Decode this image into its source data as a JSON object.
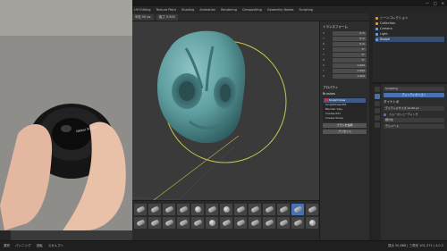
{
  "window": {
    "title": "(未保存) - Blender 4.0",
    "controls": [
      "—",
      "□",
      "✕"
    ]
  },
  "menubar": {
    "menus": [
      "ファイル",
      "編集",
      "レンダー",
      "ウィンドウ",
      "ヘルプ"
    ],
    "workspaces": [
      "Layout",
      "Modeling",
      "Sculpting",
      "UV Editing",
      "Texture Paint",
      "Shading",
      "Animation",
      "Rendering",
      "Compositing",
      "Geometry Nodes",
      "Scripting"
    ],
    "active_workspace": "Sculpting"
  },
  "header": {
    "items": [
      "スカルプトモード",
      "ビュー",
      "スカルプト",
      "マスク",
      "面セット",
      "Draw",
      "半径 50 px",
      "強さ 0.500"
    ]
  },
  "toolbar": {
    "tools": [
      "draw",
      "draw-sharp",
      "clay",
      "clay-strips",
      "layer",
      "inflate",
      "blob",
      "crease",
      "smooth",
      "flatten",
      "fill",
      "scrape",
      "pinch",
      "grab",
      "snake-hook",
      "thumb",
      "pose",
      "nudge",
      "rotate",
      "mask"
    ],
    "active_index": 0
  },
  "camera_overlay": {
    "lens_label": "Nikkor 50mm"
  },
  "n_panel": {
    "transform_title": "トランスフォーム",
    "transform_rows": [
      {
        "label": "X",
        "value": "0 m"
      },
      {
        "label": "Y",
        "value": "0 m"
      },
      {
        "label": "Z",
        "value": "0 m"
      },
      {
        "label": "X",
        "value": "0°"
      },
      {
        "label": "Y",
        "value": "0°"
      },
      {
        "label": "Z",
        "value": "0°"
      },
      {
        "label": "X",
        "value": "1.000"
      },
      {
        "label": "Y",
        "value": "1.000"
      },
      {
        "label": "Z",
        "value": "1.000"
      }
    ],
    "properties_title": "プロパティ",
    "brush_title": "Brushes",
    "brush_list": [
      "Sculpt Draw",
      "SculptDraw.001",
      "Blender Clay",
      "Crease.001",
      "Crease Sharp"
    ],
    "brush_selected_index": 0,
    "apply_button": "ブラシを適用",
    "extra_label": "プリセット"
  },
  "outliner": {
    "items": [
      {
        "label": "シーンコレクション",
        "type": "collection"
      },
      {
        "label": "Collection",
        "type": "collection"
      },
      {
        "label": "Camera",
        "type": "object"
      },
      {
        "label": "Light",
        "type": "object"
      },
      {
        "label": "Sculpt",
        "type": "mesh"
      }
    ],
    "selected_index": 4
  },
  "properties": {
    "search_field": "Sculpting",
    "mode_button": "ディンティポリゴン",
    "section_title": "ダイナトポ",
    "detail_field": "ディティルサイズ 12.00 px",
    "option_label": "スムーズシェーディング",
    "refine_label": "細分化",
    "decimate_label": "デシメート"
  },
  "shelf": {
    "brushes": [
      "draw",
      "draw-sharp",
      "clay",
      "clay-strips",
      "clay-thumb",
      "layer",
      "inflate",
      "blob",
      "crease",
      "smooth",
      "flatten",
      "fill",
      "scrape",
      "multiplane",
      "pinch",
      "grab",
      "elastic",
      "snake-hook",
      "thumb",
      "pose",
      "nudge",
      "rotate",
      "slide",
      "boundary",
      "cloth",
      "simplify",
      "mask",
      "draw-face-sets",
      "multires",
      "paint",
      "smear",
      "boundary-2",
      "grab-2",
      "pinch-2"
    ],
    "active_index": 11
  },
  "statusbar": {
    "items": [
      "選択",
      "パンニング",
      "回転",
      "スカルプト"
    ],
    "version": "頂点 50,688 | 三角形 101,372 | 4.0.2"
  },
  "colors": {
    "accent": "#4772b3",
    "viewport_bg": "#3a3a3a",
    "sculpt_mesh": "#5f9ea0",
    "ring": "#c8c84a"
  }
}
